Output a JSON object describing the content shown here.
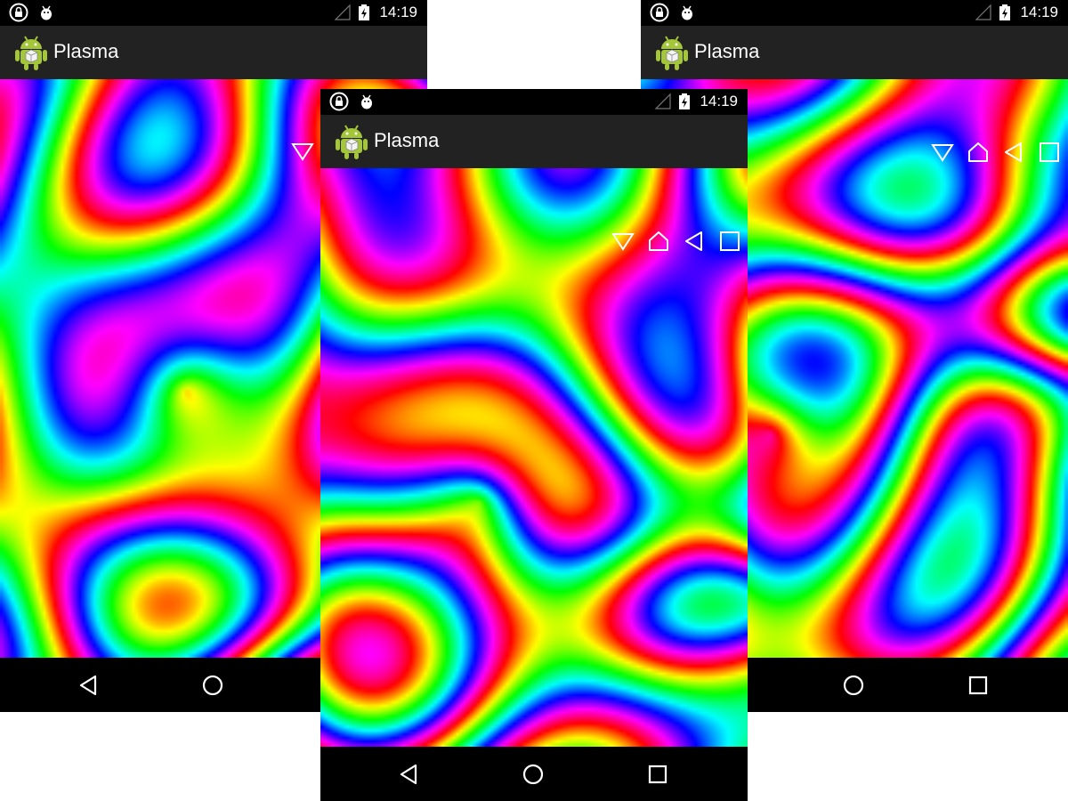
{
  "screens": [
    {
      "id": "left",
      "status_time": "14:19",
      "app_title": "Plasma",
      "overlay_icons": [
        "triangle-down-outline-icon"
      ],
      "nav_buttons": [
        "back-icon",
        "home-icon"
      ]
    },
    {
      "id": "center",
      "status_time": "14:19",
      "app_title": "Plasma",
      "overlay_icons": [
        "triangle-down-outline-icon",
        "house-outline-icon",
        "triangle-left-outline-icon",
        "square-outline-icon"
      ],
      "nav_buttons": [
        "back-icon",
        "home-icon",
        "recents-icon"
      ]
    },
    {
      "id": "right",
      "status_time": "14:19",
      "app_title": "Plasma",
      "overlay_icons": [
        "triangle-down-outline-icon",
        "house-outline-icon",
        "triangle-left-outline-icon",
        "square-outline-icon"
      ],
      "nav_buttons": [
        "home-icon",
        "recents-icon"
      ]
    }
  ],
  "colors": {
    "statusbar_bg": "#000000",
    "actionbar_bg": "#222222",
    "navbar_bg": "#000000",
    "page_bg": "#ffffff",
    "android_green": "#a4c639"
  }
}
